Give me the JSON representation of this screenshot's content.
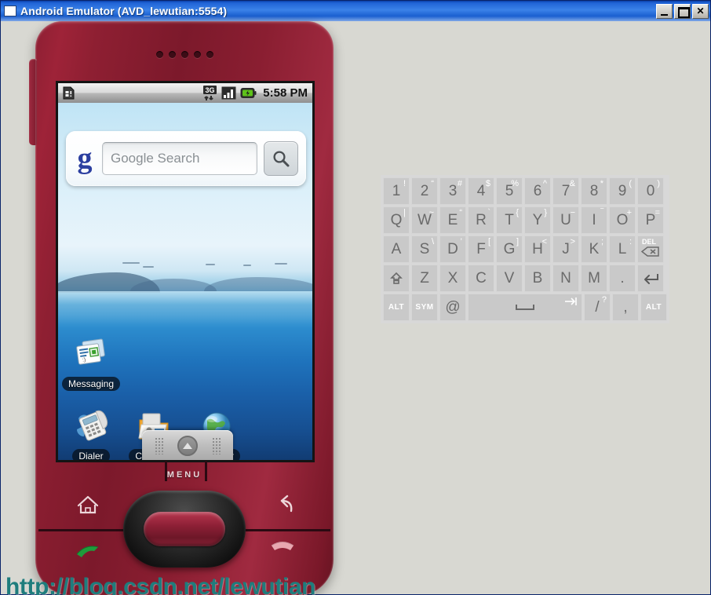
{
  "window": {
    "title": "Android Emulator (AVD_lewutian:5554)",
    "icon": "window-icon",
    "buttons": {
      "minimize": "_",
      "maximize": "□",
      "close": "✕"
    }
  },
  "phone": {
    "status_bar": {
      "sim_icon": "sim-card-icon",
      "network_icon": "3g-data-icon",
      "network_label": "3G",
      "signal_icon": "signal-bars-icon",
      "battery_icon": "battery-charging-icon",
      "time": "5:58 PM"
    },
    "search_widget": {
      "logo": "google-g-logo",
      "placeholder": "Google Search",
      "value": "",
      "button_icon": "magnifier-icon"
    },
    "home_icons": [
      {
        "name": "messaging",
        "label": "Messaging",
        "icon": "messaging-icon"
      },
      {
        "name": "dialer",
        "label": "Dialer",
        "icon": "dialer-icon"
      },
      {
        "name": "contacts",
        "label": "Contacts",
        "icon": "contacts-icon"
      },
      {
        "name": "browser",
        "label": "Browser",
        "icon": "browser-globe-icon"
      }
    ],
    "app_drawer": {
      "arrow_icon": "drawer-up-arrow-icon",
      "grip_icon": "grip-dots-icon"
    },
    "hardware": {
      "menu_label": "MENU",
      "home_icon": "home-icon",
      "back_icon": "back-arrow-icon",
      "call_icon": "call-green-icon",
      "end_call_icon": "end-call-red-icon",
      "trackball": "trackball"
    }
  },
  "keyboard": {
    "rows": [
      [
        {
          "main": "1",
          "sup": "!"
        },
        {
          "main": "2",
          "sup": "“"
        },
        {
          "main": "3",
          "sup": "#"
        },
        {
          "main": "4",
          "sup": "$"
        },
        {
          "main": "5",
          "sup": "%"
        },
        {
          "main": "6",
          "sup": "^"
        },
        {
          "main": "7",
          "sup": "&"
        },
        {
          "main": "8",
          "sup": "*"
        },
        {
          "main": "9",
          "sup": "("
        },
        {
          "main": "0",
          "sup": ")"
        }
      ],
      [
        {
          "main": "Q",
          "sup": "|"
        },
        {
          "main": "W",
          "sup": "~"
        },
        {
          "main": "E",
          "sup": "“"
        },
        {
          "main": "R",
          "sup": "`"
        },
        {
          "main": "T",
          "sup": "{"
        },
        {
          "main": "Y",
          "sup": "}"
        },
        {
          "main": "U",
          "sup": "−"
        },
        {
          "main": "I",
          "sup": "‾"
        },
        {
          "main": "O",
          "sup": "+"
        },
        {
          "main": "P",
          "sup": "="
        }
      ],
      [
        {
          "main": "A",
          "sup": ""
        },
        {
          "main": "S",
          "sup": "\\"
        },
        {
          "main": "D",
          "sup": "’"
        },
        {
          "main": "F",
          "sup": "["
        },
        {
          "main": "G",
          "sup": "]"
        },
        {
          "main": "H",
          "sup": "<"
        },
        {
          "main": "J",
          "sup": ">"
        },
        {
          "main": "K",
          "sup": ";"
        },
        {
          "main": "L",
          "sup": ":"
        },
        {
          "main": "DEL",
          "sup": "",
          "type": "delete"
        }
      ],
      [
        {
          "main": "",
          "sup": "",
          "type": "shift"
        },
        {
          "main": "Z",
          "sup": ""
        },
        {
          "main": "X",
          "sup": ""
        },
        {
          "main": "C",
          "sup": ""
        },
        {
          "main": "V",
          "sup": ""
        },
        {
          "main": "B",
          "sup": ""
        },
        {
          "main": "N",
          "sup": ""
        },
        {
          "main": "M",
          "sup": ""
        },
        {
          "main": ".",
          "sup": ""
        },
        {
          "main": "",
          "sup": "",
          "type": "enter"
        }
      ],
      [
        {
          "main": "ALT",
          "sup": "",
          "type": "label"
        },
        {
          "main": "SYM",
          "sup": "",
          "type": "label"
        },
        {
          "main": "@",
          "sup": ""
        },
        {
          "main": "",
          "sup": "",
          "type": "space"
        },
        {
          "main": "/",
          "sup": "?"
        },
        {
          "main": ",",
          "sup": ""
        },
        {
          "main": "ALT",
          "sup": "",
          "type": "label"
        }
      ]
    ]
  },
  "watermark": {
    "text": "http://blog.csdn.net/lewutian"
  },
  "colors": {
    "titlebar": "#1f63d6",
    "phone_body": "#8a1e31",
    "key_face": "#c9c9c9",
    "watermark": "#1e7d7d",
    "accent_google": "#2b3fa0"
  }
}
